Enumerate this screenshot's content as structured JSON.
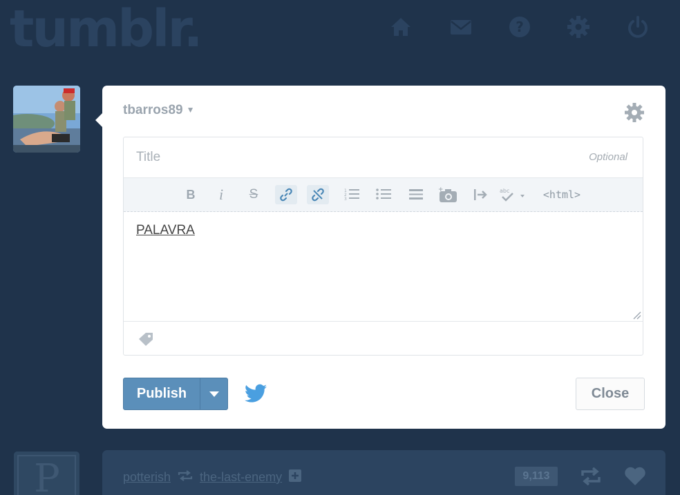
{
  "header": {
    "logo_text": "tumblr.",
    "nav": [
      "home-icon",
      "mail-icon",
      "help-icon",
      "settings-icon",
      "power-icon"
    ]
  },
  "post_form": {
    "blog_name": "tbarros89",
    "title_placeholder": "Title",
    "optional_label": "Optional",
    "toolbar": {
      "bold": "B",
      "italic": "i",
      "strike": "S",
      "html": "<html>"
    },
    "body_text": "PALAVRA",
    "publish_label": "Publish",
    "close_label": "Close"
  },
  "background_post": {
    "user": "potterish",
    "reblogged_from": "the-last-enemy",
    "notes": "9,113",
    "avatar_letter": "P"
  },
  "colors": {
    "background": "#1f334b",
    "publish": "#5b8fba",
    "twitter": "#4a9fe0"
  }
}
